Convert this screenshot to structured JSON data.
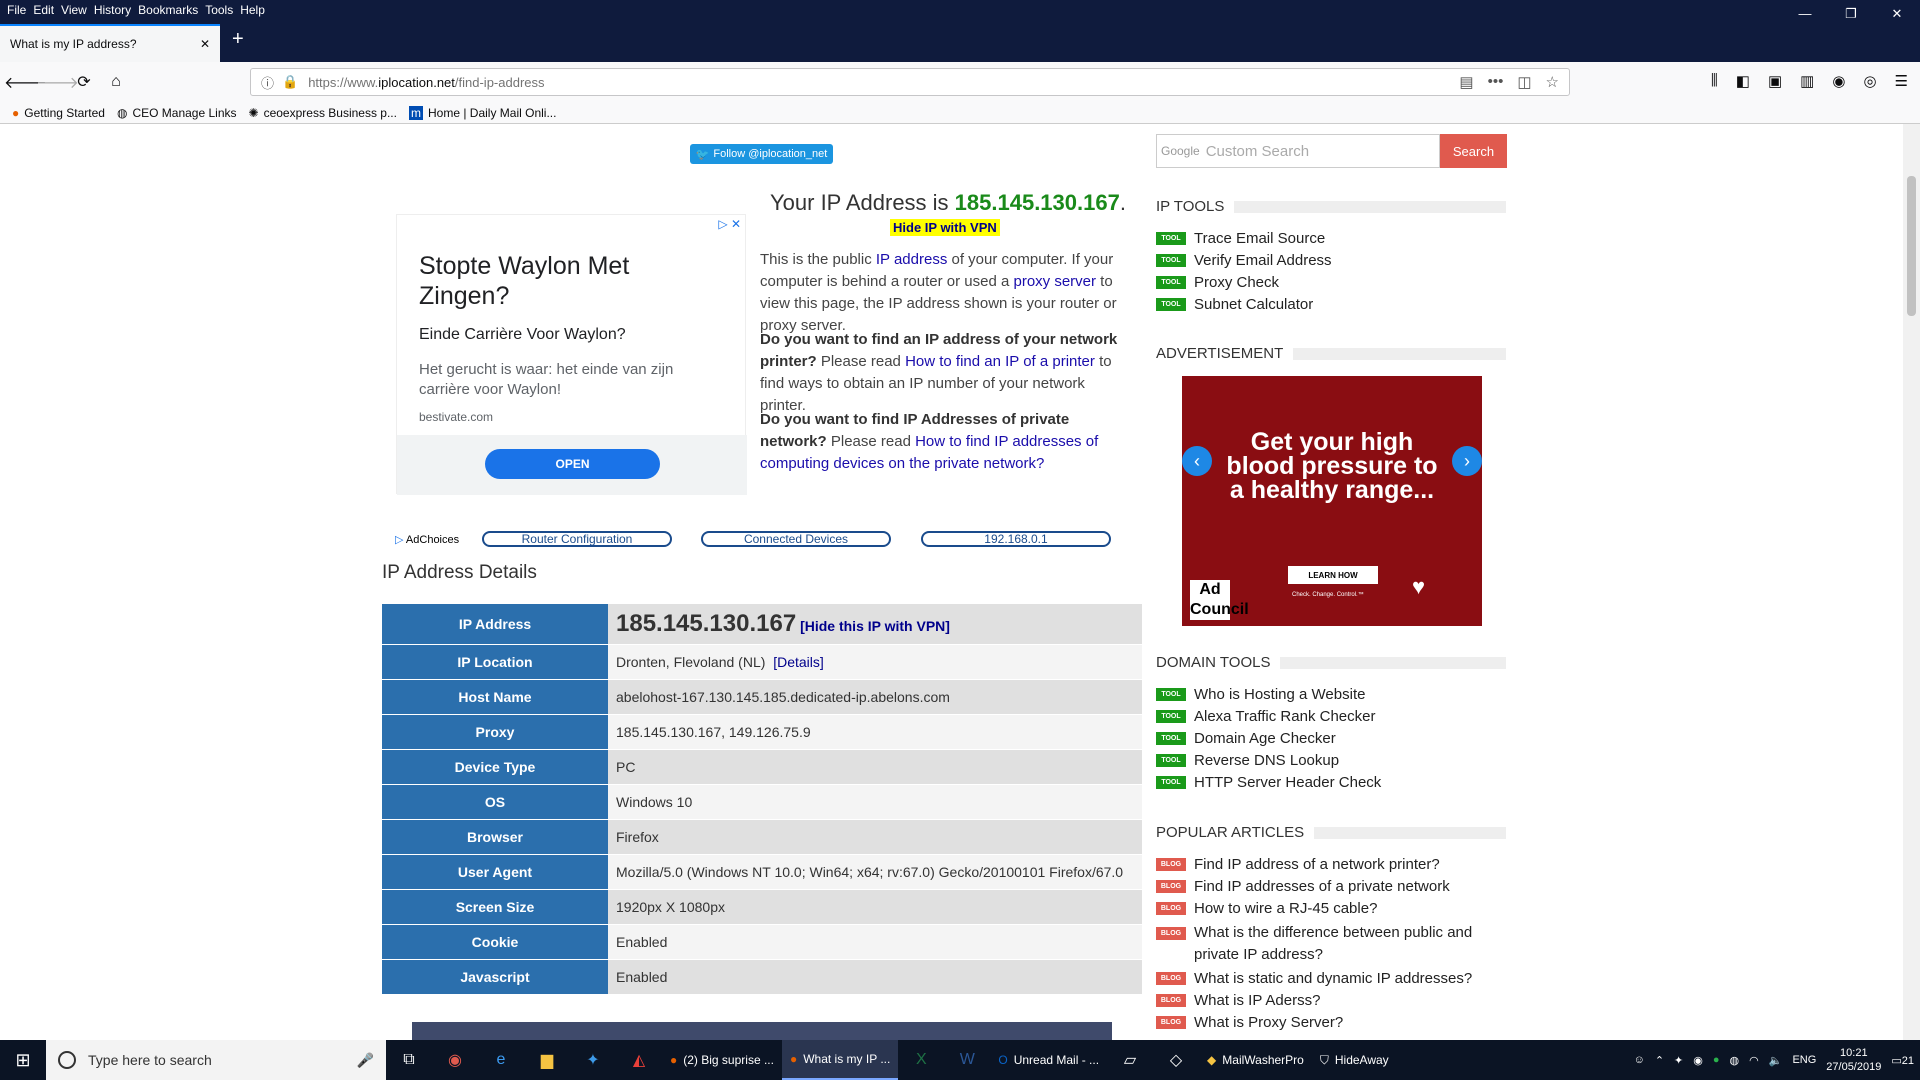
{
  "menu": [
    "File",
    "Edit",
    "View",
    "History",
    "Bookmarks",
    "Tools",
    "Help"
  ],
  "window_controls": [
    "—",
    "❐",
    "✕"
  ],
  "tab": {
    "title": "What is my IP address?",
    "close": "✕",
    "new": "+"
  },
  "url": {
    "prefix": "https://www.",
    "host": "iplocation.net",
    "path": "/find-ip-address"
  },
  "bookmarks": [
    "Getting Started",
    "CEO Manage Links",
    "ceoexpress Business p...",
    "Home | Daily Mail Onli..."
  ],
  "twitter": "Follow @iplocation_net",
  "ad": {
    "title": "Stopte Waylon Met Zingen?",
    "subtitle": "Einde Carrière Voor Waylon?",
    "desc": "Het gerucht is waar: het einde van zijn carrière voor Waylon!",
    "url": "bestivate.com",
    "button": "OPEN",
    "controls": "▷ ✕"
  },
  "ip_header": {
    "prefix": "Your IP Address is ",
    "ip": "185.145.130.167",
    "suffix": ".",
    "vpn": "Hide IP with VPN"
  },
  "desc1": {
    "a": "This is the public ",
    "link1": "IP address",
    "b": " of your computer. If your computer is behind a router or used a ",
    "link2": "proxy server",
    "c": " to view this page, the IP address shown is your router or proxy server."
  },
  "desc2": {
    "q": "Do you want to find an IP address of your network printer?",
    "a": " Please read ",
    "link": "How to find an IP of a printer",
    "b": " to find ways to obtain an IP number of your network printer."
  },
  "desc3": {
    "q": "Do you want to find IP Addresses of private network?",
    "a": " Please read ",
    "link": "How to find IP addresses of computing devices on the private network?"
  },
  "adchoices": "AdChoices",
  "pills": [
    "Router Configuration",
    "Connected Devices",
    "192.168.0.1"
  ],
  "details_title": "IP Address Details",
  "details": {
    "ip_label": "IP Address",
    "ip_value": "185.145.130.167",
    "ip_link": "[Hide this IP with VPN]",
    "loc_label": "IP Location",
    "loc_value": "Dronten, Flevoland (NL)",
    "loc_link": "[Details]",
    "rows": [
      {
        "k": "Host Name",
        "v": "abelohost-167.130.145.185.dedicated-ip.abelons.com"
      },
      {
        "k": "Proxy",
        "v": "185.145.130.167, 149.126.75.9"
      },
      {
        "k": "Device Type",
        "v": "PC"
      },
      {
        "k": "OS",
        "v": "Windows 10"
      },
      {
        "k": "Browser",
        "v": "Firefox"
      },
      {
        "k": "User Agent",
        "v": "Mozilla/5.0 (Windows NT 10.0; Win64; x64; rv:67.0) Gecko/20100101 Firefox/67.0"
      },
      {
        "k": "Screen Size",
        "v": "1920px X 1080px"
      },
      {
        "k": "Cookie",
        "v": "Enabled"
      },
      {
        "k": "Javascript",
        "v": "Enabled"
      }
    ]
  },
  "search": {
    "google": "Google",
    "placeholder": "Custom Search",
    "button": "Search"
  },
  "ip_tools": {
    "title": "IP TOOLS",
    "tag": "TOOL",
    "items": [
      "Trace Email Source",
      "Verify Email Address",
      "Proxy Check",
      "Subnet Calculator"
    ]
  },
  "advertisement": {
    "title": "ADVERTISEMENT",
    "text": "Get your high blood pressure to a healthy range...",
    "learn": "LEARN HOW",
    "tagline": "Check. Change. Control.™",
    "logo": "Ad Council"
  },
  "domain_tools": {
    "title": "DOMAIN TOOLS",
    "tag": "TOOL",
    "items": [
      "Who is Hosting a Website",
      "Alexa Traffic Rank Checker",
      "Domain Age Checker",
      "Reverse DNS Lookup",
      "HTTP Server Header Check"
    ]
  },
  "popular": {
    "title": "POPULAR ARTICLES",
    "tag": "BLOG",
    "items": [
      "Find IP address of a network printer?",
      "Find IP addresses of a private network",
      "How to wire a RJ-45 cable?",
      "What is the difference between public and private IP address?",
      "What is static and dynamic IP addresses?",
      "What is IP Aderss?",
      "What is Proxy Server?"
    ]
  },
  "taskbar": {
    "search": "Type here to search",
    "apps": [
      "(2) Big suprise ...",
      "What is my IP ...",
      "Unread Mail - ...",
      "MailWasherPro",
      "HideAway"
    ],
    "lang": "ENG",
    "time": "10:21",
    "date": "27/05/2019",
    "notif": "21"
  },
  "colors": {
    "titlebar": "#0f1b3d",
    "table_key": "#2b6fad",
    "ip_green": "#1a8a1a",
    "search_btn": "#e05a4e",
    "tool_tag": "#1a9a1a",
    "blog_tag": "#e05a4e"
  }
}
